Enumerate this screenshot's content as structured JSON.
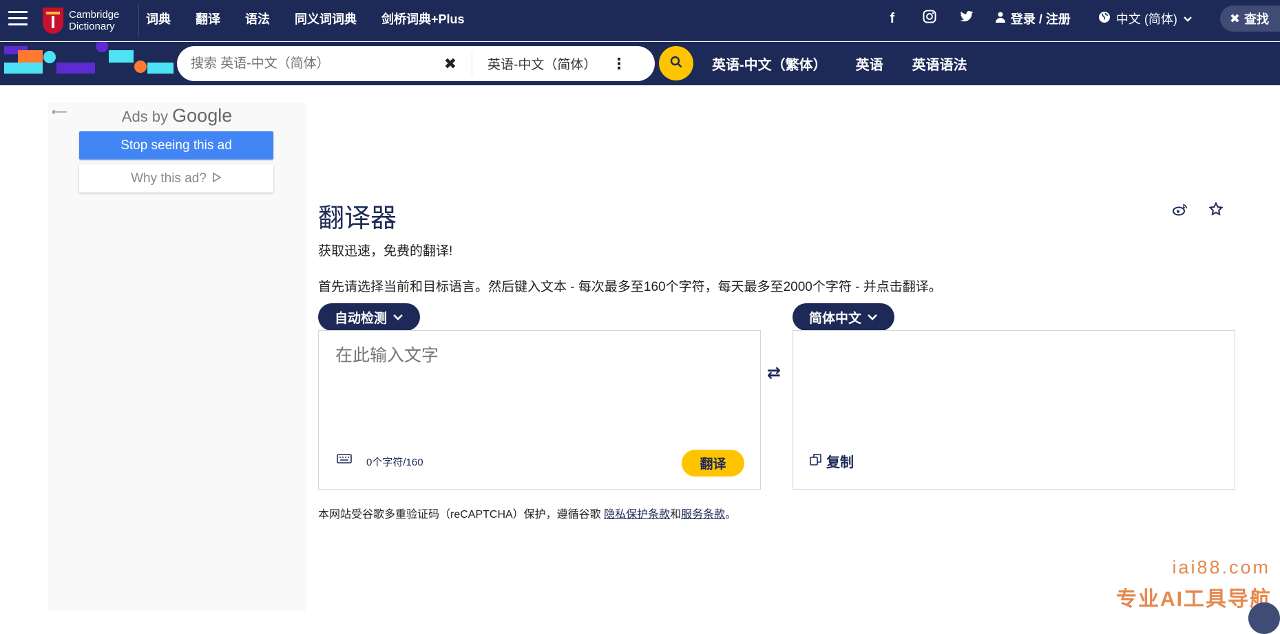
{
  "header": {
    "logo_line1": "Cambridge",
    "logo_line2": "Dictionary",
    "nav": [
      "词典",
      "翻译",
      "语法",
      "同义词词典",
      "剑桥词典+Plus"
    ],
    "social": {
      "facebook": "f",
      "instagram": "◎",
      "twitter": "🐦"
    },
    "login_label": "登录 / 注册",
    "language_label": "中文 (简体)",
    "search_toggle_label": "查找"
  },
  "search": {
    "placeholder": "搜索 英语-中文（简体）",
    "dictionary_label": "英语-中文（简体）",
    "subnav": [
      "英语-中文（繁体）",
      "英语",
      "英语语法"
    ]
  },
  "ad": {
    "ads_by": "Ads by",
    "google": "Google",
    "stop_label": "Stop seeing this ad",
    "why_label": "Why this ad?"
  },
  "translator": {
    "title": "翻译器",
    "subtitle": "获取迅速，免费的翻译!",
    "instructions": "首先请选择当前和目标语言。然后键入文本 - 每次最多至160个字符，每天最多至2000个字符 - 并点击翻译。",
    "source_lang": "自动检测",
    "target_lang": "简体中文",
    "input_placeholder": "在此输入文字",
    "char_count": "0个字符/160",
    "translate_label": "翻译",
    "copy_label": "复制",
    "recaptcha_prefix": "本网站受谷歌多重验证码（reCAPTCHA）保护，遵循谷歌 ",
    "privacy_link": "隐私保护条款",
    "and": "和",
    "terms_link": "服务条款",
    "recaptcha_suffix": "。"
  },
  "watermark": {
    "line1": "iai88.com",
    "line2": "专业AI工具导航"
  },
  "colors": {
    "navy": "#1d2a57",
    "yellow": "#fec400",
    "google_blue": "#4285f4"
  }
}
